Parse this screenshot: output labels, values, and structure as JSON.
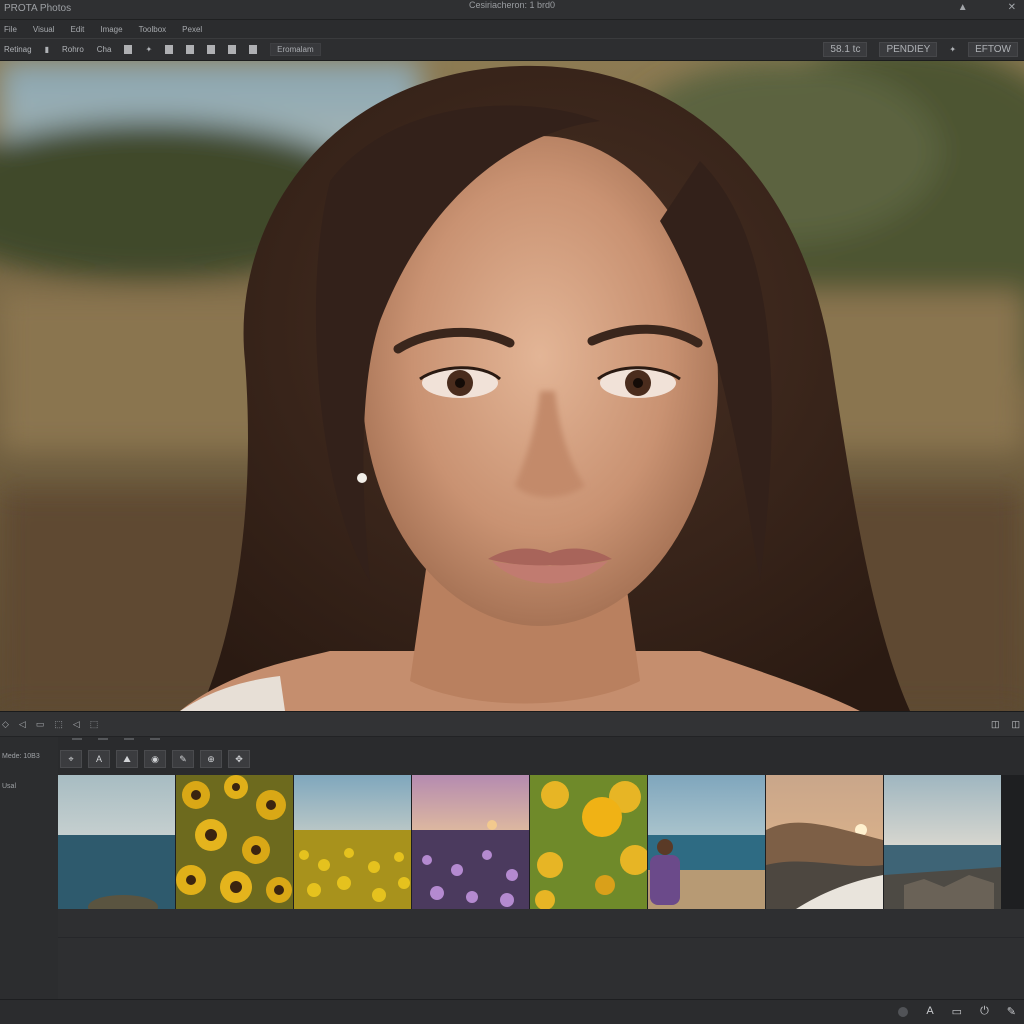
{
  "window": {
    "app_name": "PROTA Photos",
    "document_title": "Cesiriacheron: 1 brd0",
    "controls": [
      "▲",
      "✕"
    ]
  },
  "menubar": {
    "items": [
      "File",
      "Visual",
      "Edit",
      "Image",
      "Toolbox",
      "Pexel"
    ]
  },
  "toolbar": {
    "items": [
      "Retinag",
      "▮",
      "Rohro",
      "Cha",
      "✦"
    ],
    "preset_box": "Eromalam",
    "zoom_value": "58.1 tc",
    "mode_label": "PENDIEY",
    "view_label": "EFTOW"
  },
  "panel_header": {
    "icons": [
      "◇",
      "◁",
      "▭",
      "⬚",
      "◁",
      "⬚"
    ],
    "right_icons": [
      "◫",
      "◫"
    ]
  },
  "filmstrip_panel": {
    "mode_label": "Mede: 10B3",
    "section_label": "Usal",
    "tool_buttons": [
      "⌖",
      "A",
      "⛰",
      "◉",
      "✎",
      "⊕",
      "✥"
    ]
  },
  "thumbnails": [
    {
      "subject": "ocean horizon with rock"
    },
    {
      "subject": "sunflowers close-up"
    },
    {
      "subject": "sunflower field"
    },
    {
      "subject": "purple flowers at sunset"
    },
    {
      "subject": "yellow poppies"
    },
    {
      "subject": "person on beach"
    },
    {
      "subject": "coastal sunset"
    },
    {
      "subject": "rocky seashore"
    }
  ],
  "statusbar": {
    "icons": [
      "A",
      "▭",
      "⏻",
      "✎"
    ]
  },
  "colors": {
    "chrome": "#2b2c2e",
    "panel": "#323335",
    "text": "#b9bbbe"
  }
}
